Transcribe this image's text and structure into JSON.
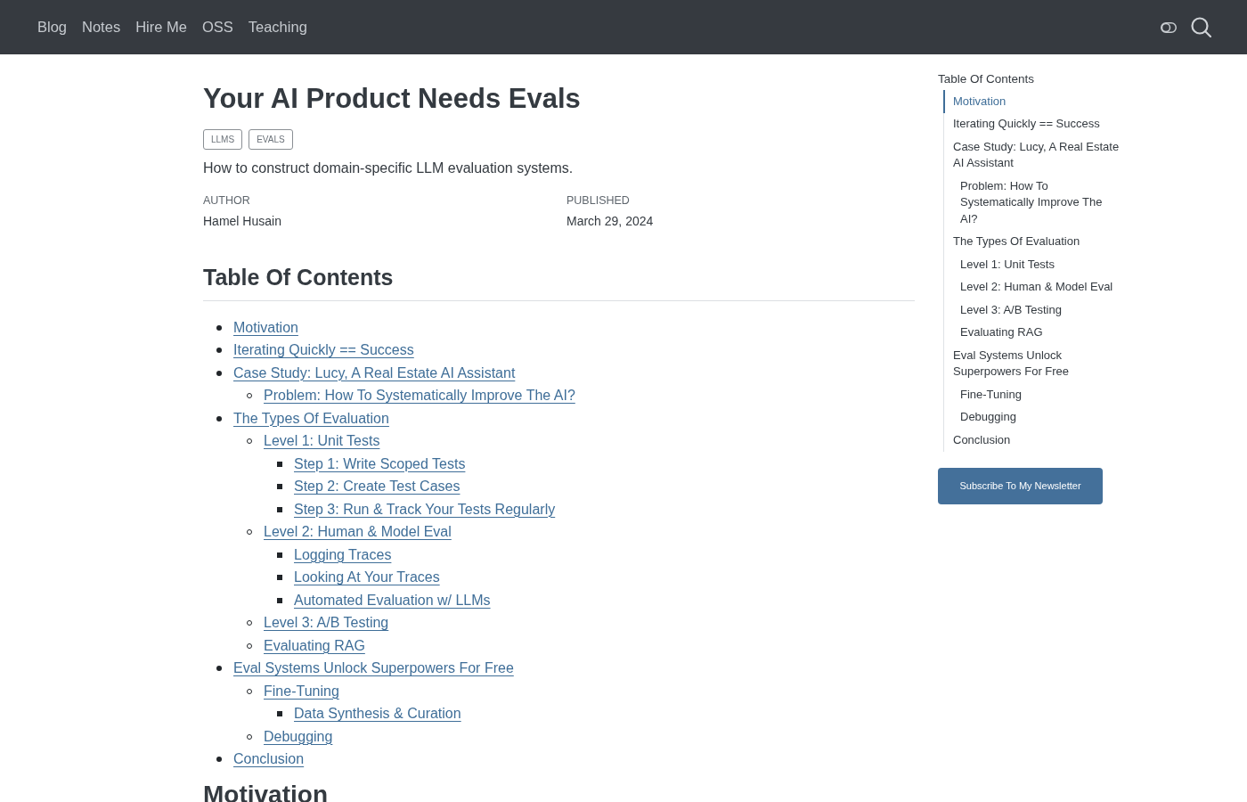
{
  "nav": {
    "links": [
      "Blog",
      "Notes",
      "Hire Me",
      "OSS",
      "Teaching"
    ]
  },
  "article": {
    "title": "Your AI Product Needs Evals",
    "tags": [
      "LLMS",
      "EVALS"
    ],
    "description": "How to construct domain-specific LLM evaluation systems.",
    "meta": [
      {
        "label": "AUTHOR",
        "value": "Hamel Husain"
      },
      {
        "label": "PUBLISHED",
        "value": "March 29, 2024"
      }
    ],
    "toc": {
      "heading": "Table Of Contents",
      "items": [
        {
          "label": "Motivation"
        },
        {
          "label": "Iterating Quickly == Success"
        },
        {
          "label": "Case Study: Lucy, A Real Estate AI Assistant",
          "children": [
            {
              "label": "Problem: How To Systematically Improve The AI?"
            }
          ]
        },
        {
          "label": "The Types Of Evaluation",
          "children": [
            {
              "label": "Level 1: Unit Tests",
              "children": [
                {
                  "label": "Step 1: Write Scoped Tests"
                },
                {
                  "label": "Step 2: Create Test Cases"
                },
                {
                  "label": "Step 3: Run & Track Your Tests Regularly"
                }
              ]
            },
            {
              "label": "Level 2: Human & Model Eval",
              "children": [
                {
                  "label": "Logging Traces"
                },
                {
                  "label": "Looking At Your Traces"
                },
                {
                  "label": "Automated Evaluation w/ LLMs"
                }
              ]
            },
            {
              "label": "Level 3: A/B Testing"
            },
            {
              "label": "Evaluating RAG"
            }
          ]
        },
        {
          "label": "Eval Systems Unlock Superpowers For Free",
          "children": [
            {
              "label": "Fine-Tuning",
              "children": [
                {
                  "label": "Data Synthesis & Curation"
                }
              ]
            },
            {
              "label": "Debugging"
            }
          ]
        },
        {
          "label": "Conclusion"
        }
      ]
    },
    "next_heading": "Motivation"
  },
  "sidebar": {
    "heading": "Table Of Contents",
    "items": [
      {
        "label": "Motivation",
        "selected": true
      },
      {
        "label": "Iterating Quickly == Success",
        "selected": false
      },
      {
        "label": "Case Study: Lucy, A Real Estate AI Assistant",
        "selected": false,
        "children": [
          {
            "label": "Problem: How To Systematically Improve The AI?",
            "selected": false
          }
        ]
      },
      {
        "label": "The Types Of Evaluation",
        "selected": false,
        "children": [
          {
            "label": "Level 1: Unit Tests",
            "selected": false
          },
          {
            "label": "Level 2: Human & Model Eval",
            "selected": false
          },
          {
            "label": "Level 3: A/B Testing",
            "selected": false
          },
          {
            "label": "Evaluating RAG",
            "selected": false
          }
        ]
      },
      {
        "label": "Eval Systems Unlock Superpowers For Free",
        "selected": false,
        "children": [
          {
            "label": "Fine-Tuning",
            "selected": false
          },
          {
            "label": "Debugging",
            "selected": false
          }
        ]
      },
      {
        "label": "Conclusion",
        "selected": false
      }
    ],
    "subscribe_button": "Subscribe To My Newsletter"
  }
}
